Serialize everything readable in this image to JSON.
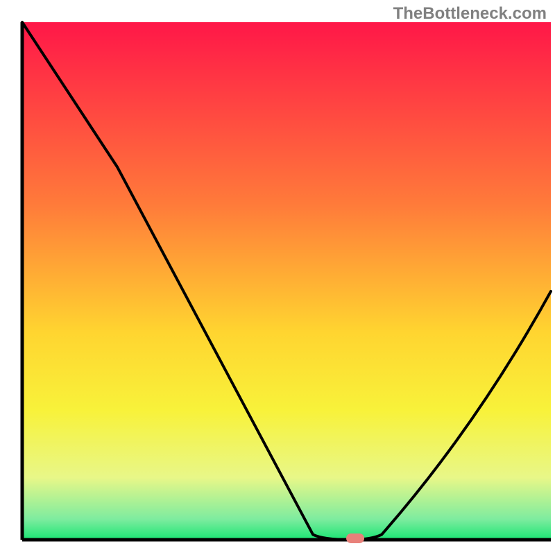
{
  "attribution": "TheBottleneck.com",
  "chart_data": {
    "type": "line",
    "title": "",
    "xlabel": "",
    "ylabel": "",
    "xlim": [
      0,
      100
    ],
    "ylim": [
      0,
      100
    ],
    "x": [
      0,
      18,
      55,
      62,
      68,
      100
    ],
    "values": [
      100,
      72,
      1,
      0,
      1,
      48
    ],
    "notch_x": 63,
    "notch_value": 0,
    "background_gradient": {
      "type": "vertical",
      "stops": [
        {
          "offset": 0,
          "color": "#ff1748"
        },
        {
          "offset": 35,
          "color": "#ff7a3a"
        },
        {
          "offset": 60,
          "color": "#ffd530"
        },
        {
          "offset": 75,
          "color": "#f8f23a"
        },
        {
          "offset": 88,
          "color": "#e8f788"
        },
        {
          "offset": 96,
          "color": "#7eec9f"
        },
        {
          "offset": 100,
          "color": "#1ae574"
        }
      ]
    },
    "marker_color": "#e8817a",
    "curve_color": "#000000",
    "axis_color": "#000000"
  }
}
